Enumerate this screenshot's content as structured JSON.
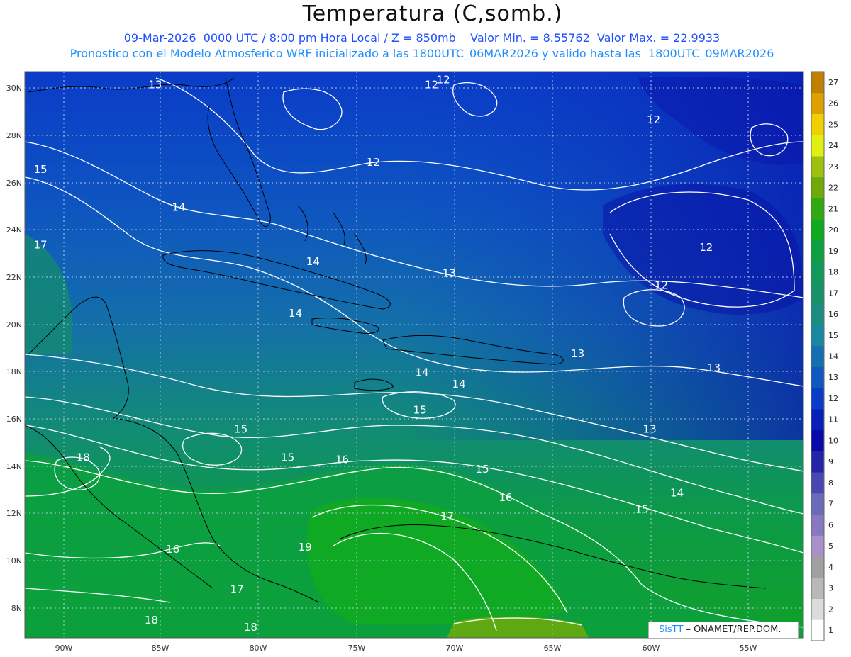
{
  "title": "Temperatura (C,somb.)",
  "subtitle_line1": "09-Mar-2026  0000 UTC / 8:00 pm Hora Local / Z = 850mb    Valor Min. = 8.55762  Valor Max. = 22.9933",
  "subtitle_line2": "Pronostico con el Modelo Atmosferico WRF inicializado a las 1800UTC_06MAR2026 y valido hasta las  1800UTC_09MAR2026",
  "credit": {
    "brand": "SisTT",
    "org": "– ONAMET/REP.DOM."
  },
  "map": {
    "lon_range": [
      -92,
      -52
    ],
    "lat_range": [
      6.5,
      30.5
    ],
    "lon_ticks": [
      "90W",
      "85W",
      "80W",
      "75W",
      "70W",
      "65W",
      "60W",
      "55W"
    ],
    "lat_ticks": [
      "30N",
      "28N",
      "26N",
      "24N",
      "22N",
      "20N",
      "18N",
      "16N",
      "14N",
      "12N",
      "10N",
      "8N"
    ],
    "grid": "dotted"
  },
  "chart_data": {
    "type": "heatmap",
    "variable": "Temperatura (C,somb.)",
    "level": "850mb",
    "valor_min": 8.55762,
    "valor_max": 22.9933,
    "colorbar": {
      "levels": [
        1,
        2,
        3,
        4,
        5,
        6,
        7,
        8,
        9,
        10,
        11,
        12,
        13,
        14,
        15,
        16,
        17,
        18,
        19,
        20,
        21,
        22,
        23,
        24,
        25,
        26,
        27
      ],
      "colors": [
        "#ffffff",
        "#dcdcdc",
        "#b8b8b8",
        "#a0a0a0",
        "#a890c8",
        "#8878c0",
        "#6a6ab8",
        "#4848b0",
        "#2424a8",
        "#0a0aa8",
        "#0820b8",
        "#0a3cc8",
        "#1058c0",
        "#1470b0",
        "#1888a0",
        "#1a8c80",
        "#189068",
        "#12985a",
        "#0ca040",
        "#10aa20",
        "#30aa10",
        "#70aa08",
        "#a0c010",
        "#e0f010",
        "#f0d000",
        "#e0a000",
        "#c08000"
      ]
    },
    "contour_labels": [
      {
        "value": 13,
        "lon": -85.3,
        "lat": 29.8
      },
      {
        "value": 12,
        "lon": -71.1,
        "lat": 29.8
      },
      {
        "value": 12,
        "lon": -70.5,
        "lat": 30.0
      },
      {
        "value": 12,
        "lon": -59.7,
        "lat": 28.3
      },
      {
        "value": 15,
        "lon": -91.2,
        "lat": 26.2
      },
      {
        "value": 12,
        "lon": -74.1,
        "lat": 26.5
      },
      {
        "value": 14,
        "lon": -84.1,
        "lat": 24.6
      },
      {
        "value": 17,
        "lon": -91.2,
        "lat": 23.0
      },
      {
        "value": 12,
        "lon": -57.0,
        "lat": 22.9
      },
      {
        "value": 14,
        "lon": -77.2,
        "lat": 22.3
      },
      {
        "value": 13,
        "lon": -70.2,
        "lat": 21.8
      },
      {
        "value": 12,
        "lon": -59.3,
        "lat": 21.3
      },
      {
        "value": 14,
        "lon": -78.1,
        "lat": 20.1
      },
      {
        "value": 13,
        "lon": -63.6,
        "lat": 18.4
      },
      {
        "value": 13,
        "lon": -56.6,
        "lat": 17.8
      },
      {
        "value": 14,
        "lon": -71.6,
        "lat": 17.6
      },
      {
        "value": 14,
        "lon": -69.7,
        "lat": 17.1
      },
      {
        "value": 15,
        "lon": -71.7,
        "lat": 16.0
      },
      {
        "value": 15,
        "lon": -80.9,
        "lat": 15.2
      },
      {
        "value": 13,
        "lon": -59.9,
        "lat": 15.2
      },
      {
        "value": 15,
        "lon": -78.5,
        "lat": 14.0
      },
      {
        "value": 16,
        "lon": -75.7,
        "lat": 13.9
      },
      {
        "value": 18,
        "lon": -89.0,
        "lat": 14.0
      },
      {
        "value": 15,
        "lon": -68.5,
        "lat": 13.5
      },
      {
        "value": 16,
        "lon": -67.3,
        "lat": 12.3
      },
      {
        "value": 14,
        "lon": -58.5,
        "lat": 12.5
      },
      {
        "value": 15,
        "lon": -60.3,
        "lat": 11.8
      },
      {
        "value": 17,
        "lon": -70.3,
        "lat": 11.5
      },
      {
        "value": 19,
        "lon": -77.6,
        "lat": 10.2
      },
      {
        "value": 16,
        "lon": -84.4,
        "lat": 10.1
      },
      {
        "value": 17,
        "lon": -81.1,
        "lat": 8.4
      },
      {
        "value": 18,
        "lon": -85.5,
        "lat": 7.1
      },
      {
        "value": 18,
        "lon": -80.4,
        "lat": 6.8
      }
    ]
  }
}
